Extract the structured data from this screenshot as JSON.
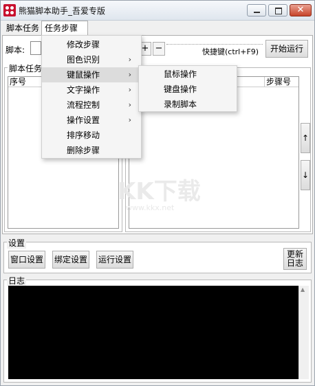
{
  "window": {
    "title": "熊猫脚本助手_吾爱专版",
    "min_glyph": "",
    "max_glyph": "",
    "close_glyph": "✕"
  },
  "tabs": [
    {
      "label": "脚本任务"
    },
    {
      "label": "任务步骤",
      "selected": true
    }
  ],
  "toolbar": {
    "script_label": "脚本:",
    "plus_label": "+",
    "minus_label": "−",
    "hotkey_label": "快捷键(ctrl+F9)",
    "start_label": "开始运行"
  },
  "left_group": {
    "title": "脚本任务",
    "col_seq": "序号"
  },
  "right_group": {
    "col_step": "步骤号",
    "up_label": "↑",
    "down_label": "↓"
  },
  "context_menu": {
    "items": [
      {
        "label": "修改步骤",
        "submenu": false
      },
      {
        "label": "图色识别",
        "submenu": true
      },
      {
        "label": "键鼠操作",
        "submenu": true,
        "highlighted": true
      },
      {
        "label": "文字操作",
        "submenu": true
      },
      {
        "label": "流程控制",
        "submenu": true
      },
      {
        "label": "操作设置",
        "submenu": true
      },
      {
        "label": "排序移动",
        "submenu": false
      },
      {
        "label": "删除步骤",
        "submenu": false
      }
    ],
    "arrow": "›"
  },
  "submenu": {
    "items": [
      {
        "label": "鼠标操作"
      },
      {
        "label": "键盘操作"
      },
      {
        "label": "录制脚本"
      }
    ]
  },
  "settings": {
    "title": "设置",
    "window_btn": "窗口设置",
    "bind_btn": "绑定设置",
    "run_btn": "运行设置",
    "update_line1": "更新",
    "update_line2": "日志"
  },
  "log": {
    "title": "日志",
    "scroll_up": "▲"
  },
  "watermark": {
    "big": "KK下载",
    "url": "www.kkx.net"
  }
}
